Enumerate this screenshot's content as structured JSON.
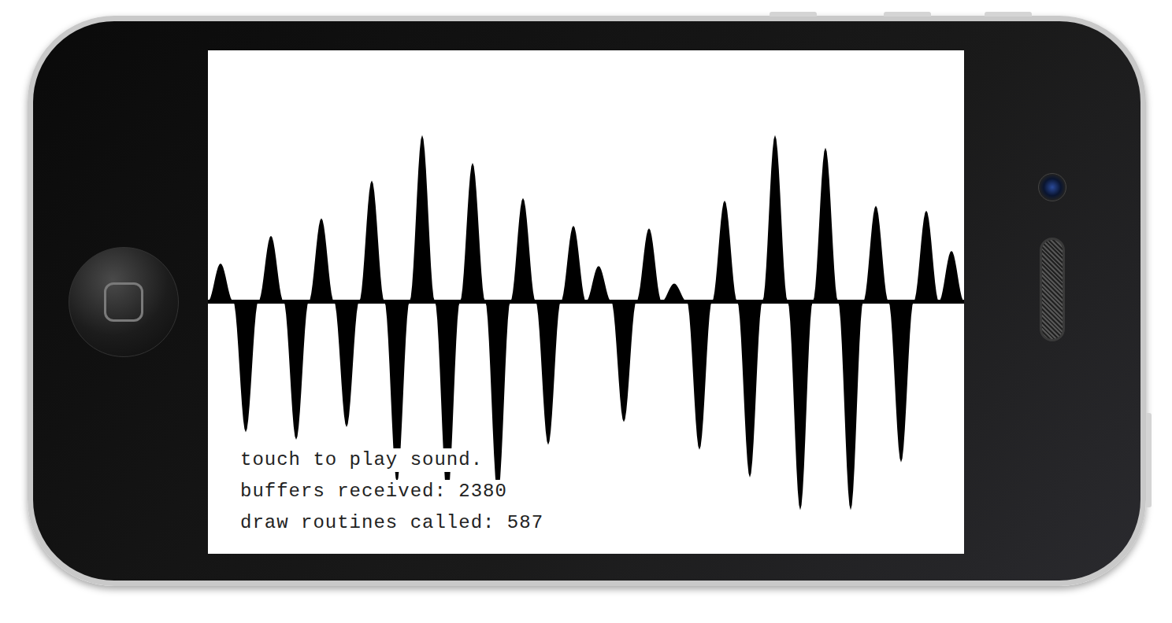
{
  "screen": {
    "waveform": {
      "values": [
        0.15,
        -0.52,
        0.26,
        -0.55,
        0.33,
        -0.5,
        0.48,
        -0.72,
        0.66,
        -0.78,
        0.55,
        -0.77,
        0.41,
        -0.57,
        0.3,
        0.14,
        -0.48,
        0.29,
        0.07,
        -0.59,
        0.4,
        -0.7,
        0.66,
        -0.83,
        0.61,
        -0.83,
        0.38,
        -0.64,
        0.36,
        0.2
      ]
    },
    "lines": [
      "touch to play sound.",
      "buffers received: 2380",
      "draw routines called: 587"
    ]
  }
}
